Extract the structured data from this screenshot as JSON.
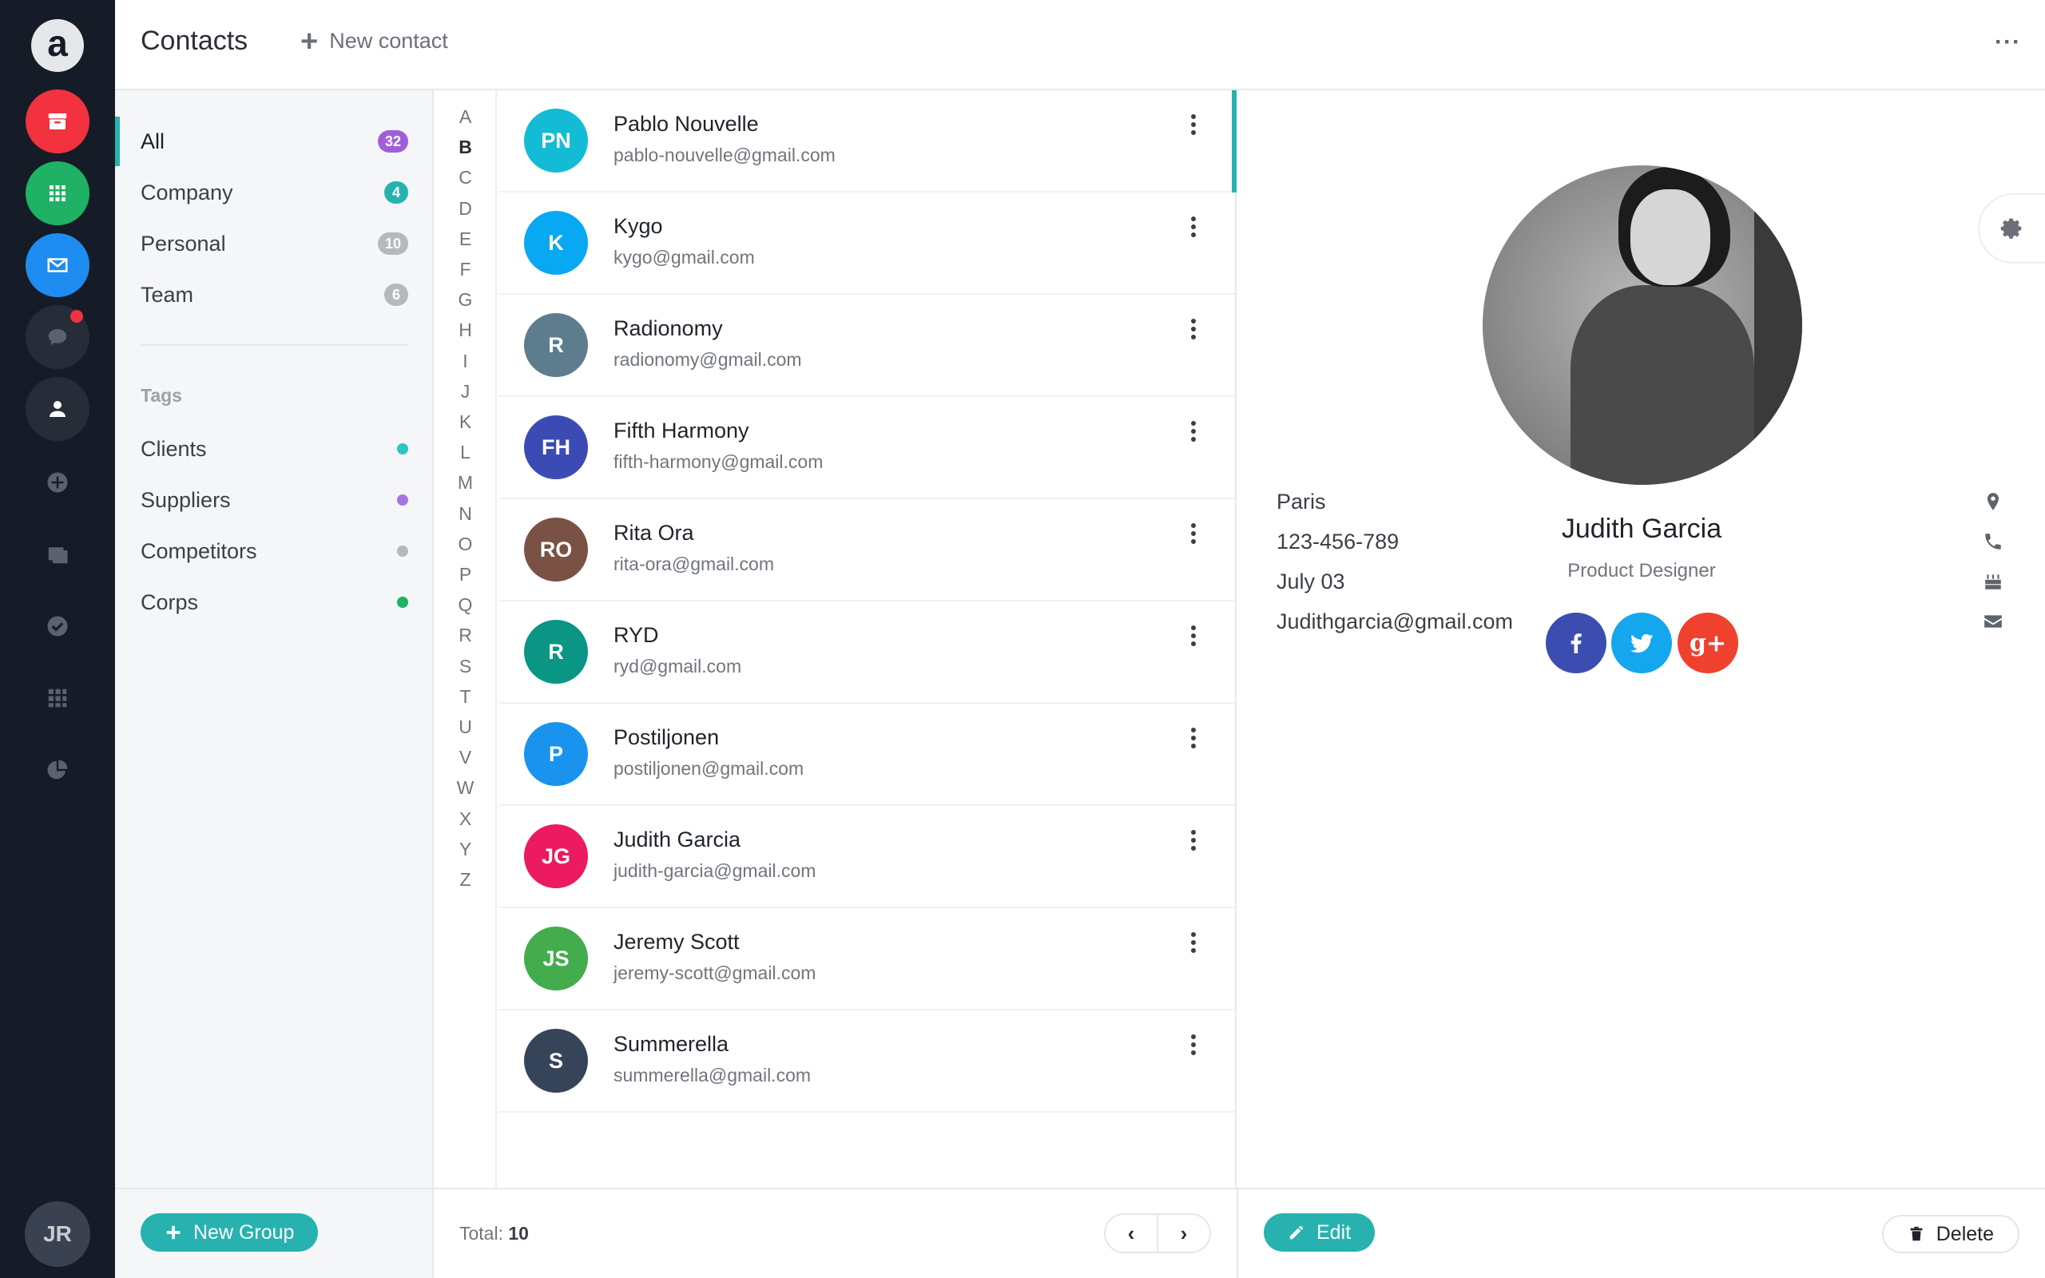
{
  "rail": {
    "logo": "a",
    "user_initials": "JR",
    "apps": [
      {
        "icon": "archive-icon",
        "color": "#f2323f"
      },
      {
        "icon": "grid-icon",
        "color": "#1fb164"
      },
      {
        "icon": "mail-icon",
        "color": "#1e8cf0"
      },
      {
        "icon": "chat-icon",
        "color": "#262c38"
      },
      {
        "icon": "contacts-icon",
        "color": "#262c38"
      }
    ],
    "nav_icons": [
      "add-circle-icon",
      "copy-icon",
      "check-circle-icon",
      "table-icon",
      "pie-chart-icon"
    ]
  },
  "header": {
    "title": "Contacts",
    "new_contact_label": "New contact",
    "more_label": "···"
  },
  "groups": {
    "items": [
      {
        "label": "All",
        "count": "32",
        "color": "#a05fd8",
        "active": true
      },
      {
        "label": "Company",
        "count": "4",
        "color": "#27b2b0"
      },
      {
        "label": "Personal",
        "count": "10",
        "color": "#b5b8bd"
      },
      {
        "label": "Team",
        "count": "6",
        "color": "#b5b8bd"
      }
    ],
    "tags_title": "Tags",
    "tags": [
      {
        "label": "Clients",
        "color": "#2ec4c2"
      },
      {
        "label": "Suppliers",
        "color": "#a773e0"
      },
      {
        "label": "Competitors",
        "color": "#b5b8bd"
      },
      {
        "label": "Corps",
        "color": "#1fb164"
      }
    ],
    "new_group_label": "New Group"
  },
  "alphabet": [
    "A",
    "B",
    "C",
    "D",
    "E",
    "F",
    "G",
    "H",
    "I",
    "J",
    "K",
    "L",
    "M",
    "N",
    "O",
    "P",
    "Q",
    "R",
    "S",
    "T",
    "U",
    "V",
    "W",
    "X",
    "Y",
    "Z"
  ],
  "alphabet_active": "B",
  "contacts": [
    {
      "initials": "PN",
      "name": "Pablo Nouvelle",
      "email": "pablo-nouvelle@gmail.com",
      "color": "#13bcd4"
    },
    {
      "initials": "K",
      "name": "Kygo",
      "email": "kygo@gmail.com",
      "color": "#08a8f3"
    },
    {
      "initials": "R",
      "name": "Radionomy",
      "email": "radionomy@gmail.com",
      "color": "#5d7d8e"
    },
    {
      "initials": "FH",
      "name": "Fifth Harmony",
      "email": "fifth-harmony@gmail.com",
      "color": "#3c4bb4"
    },
    {
      "initials": "RO",
      "name": "Rita Ora",
      "email": "rita-ora@gmail.com",
      "color": "#7a5145"
    },
    {
      "initials": "R",
      "name": "RYD",
      "email": "ryd@gmail.com",
      "color": "#0a9584"
    },
    {
      "initials": "P",
      "name": "Postiljonen",
      "email": "postiljonen@gmail.com",
      "color": "#1a93ef"
    },
    {
      "initials": "JG",
      "name": "Judith Garcia",
      "email": "judith-garcia@gmail.com",
      "color": "#eb1a61"
    },
    {
      "initials": "JS",
      "name": "Jeremy Scott",
      "email": "jeremy-scott@gmail.com",
      "color": "#43ad4d"
    },
    {
      "initials": "S",
      "name": "Summerella",
      "email": "summerella@gmail.com",
      "color": "#36445a"
    }
  ],
  "list_footer": {
    "total_label": "Total:",
    "total_value": "10",
    "prev": "‹",
    "next": "›"
  },
  "detail": {
    "name": "Judith Garcia",
    "role": "Product Designer",
    "social": [
      {
        "icon": "facebook-icon",
        "color": "#3b4db0"
      },
      {
        "icon": "twitter-icon",
        "color": "#14a7ee"
      },
      {
        "icon": "google-plus-icon",
        "color": "#f0412f"
      }
    ],
    "info": [
      {
        "text": "Paris",
        "icon": "location-pin-icon"
      },
      {
        "text": "123-456-789",
        "icon": "phone-icon"
      },
      {
        "text": "July 03",
        "icon": "birthday-cake-icon"
      },
      {
        "text": "Judithgarcia@gmail.com",
        "icon": "envelope-icon"
      }
    ],
    "edit_label": "Edit",
    "delete_label": "Delete"
  }
}
